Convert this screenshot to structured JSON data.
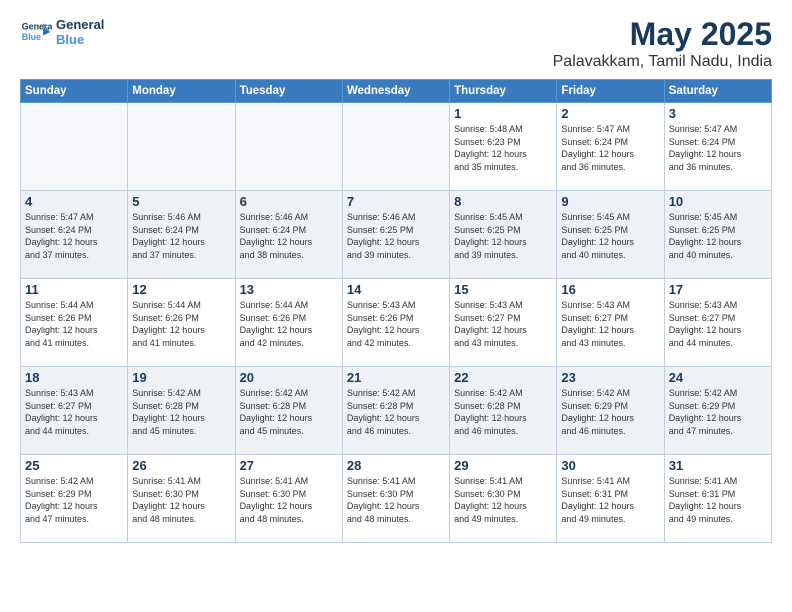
{
  "header": {
    "logo_general": "General",
    "logo_blue": "Blue",
    "title": "May 2025",
    "subtitle": "Palavakkam, Tamil Nadu, India"
  },
  "weekdays": [
    "Sunday",
    "Monday",
    "Tuesday",
    "Wednesday",
    "Thursday",
    "Friday",
    "Saturday"
  ],
  "weeks": [
    [
      {
        "day": "",
        "info": ""
      },
      {
        "day": "",
        "info": ""
      },
      {
        "day": "",
        "info": ""
      },
      {
        "day": "",
        "info": ""
      },
      {
        "day": "1",
        "info": "Sunrise: 5:48 AM\nSunset: 6:23 PM\nDaylight: 12 hours\nand 35 minutes."
      },
      {
        "day": "2",
        "info": "Sunrise: 5:47 AM\nSunset: 6:24 PM\nDaylight: 12 hours\nand 36 minutes."
      },
      {
        "day": "3",
        "info": "Sunrise: 5:47 AM\nSunset: 6:24 PM\nDaylight: 12 hours\nand 36 minutes."
      }
    ],
    [
      {
        "day": "4",
        "info": "Sunrise: 5:47 AM\nSunset: 6:24 PM\nDaylight: 12 hours\nand 37 minutes."
      },
      {
        "day": "5",
        "info": "Sunrise: 5:46 AM\nSunset: 6:24 PM\nDaylight: 12 hours\nand 37 minutes."
      },
      {
        "day": "6",
        "info": "Sunrise: 5:46 AM\nSunset: 6:24 PM\nDaylight: 12 hours\nand 38 minutes."
      },
      {
        "day": "7",
        "info": "Sunrise: 5:46 AM\nSunset: 6:25 PM\nDaylight: 12 hours\nand 39 minutes."
      },
      {
        "day": "8",
        "info": "Sunrise: 5:45 AM\nSunset: 6:25 PM\nDaylight: 12 hours\nand 39 minutes."
      },
      {
        "day": "9",
        "info": "Sunrise: 5:45 AM\nSunset: 6:25 PM\nDaylight: 12 hours\nand 40 minutes."
      },
      {
        "day": "10",
        "info": "Sunrise: 5:45 AM\nSunset: 6:25 PM\nDaylight: 12 hours\nand 40 minutes."
      }
    ],
    [
      {
        "day": "11",
        "info": "Sunrise: 5:44 AM\nSunset: 6:26 PM\nDaylight: 12 hours\nand 41 minutes."
      },
      {
        "day": "12",
        "info": "Sunrise: 5:44 AM\nSunset: 6:26 PM\nDaylight: 12 hours\nand 41 minutes."
      },
      {
        "day": "13",
        "info": "Sunrise: 5:44 AM\nSunset: 6:26 PM\nDaylight: 12 hours\nand 42 minutes."
      },
      {
        "day": "14",
        "info": "Sunrise: 5:43 AM\nSunset: 6:26 PM\nDaylight: 12 hours\nand 42 minutes."
      },
      {
        "day": "15",
        "info": "Sunrise: 5:43 AM\nSunset: 6:27 PM\nDaylight: 12 hours\nand 43 minutes."
      },
      {
        "day": "16",
        "info": "Sunrise: 5:43 AM\nSunset: 6:27 PM\nDaylight: 12 hours\nand 43 minutes."
      },
      {
        "day": "17",
        "info": "Sunrise: 5:43 AM\nSunset: 6:27 PM\nDaylight: 12 hours\nand 44 minutes."
      }
    ],
    [
      {
        "day": "18",
        "info": "Sunrise: 5:43 AM\nSunset: 6:27 PM\nDaylight: 12 hours\nand 44 minutes."
      },
      {
        "day": "19",
        "info": "Sunrise: 5:42 AM\nSunset: 6:28 PM\nDaylight: 12 hours\nand 45 minutes."
      },
      {
        "day": "20",
        "info": "Sunrise: 5:42 AM\nSunset: 6:28 PM\nDaylight: 12 hours\nand 45 minutes."
      },
      {
        "day": "21",
        "info": "Sunrise: 5:42 AM\nSunset: 6:28 PM\nDaylight: 12 hours\nand 46 minutes."
      },
      {
        "day": "22",
        "info": "Sunrise: 5:42 AM\nSunset: 6:28 PM\nDaylight: 12 hours\nand 46 minutes."
      },
      {
        "day": "23",
        "info": "Sunrise: 5:42 AM\nSunset: 6:29 PM\nDaylight: 12 hours\nand 46 minutes."
      },
      {
        "day": "24",
        "info": "Sunrise: 5:42 AM\nSunset: 6:29 PM\nDaylight: 12 hours\nand 47 minutes."
      }
    ],
    [
      {
        "day": "25",
        "info": "Sunrise: 5:42 AM\nSunset: 6:29 PM\nDaylight: 12 hours\nand 47 minutes."
      },
      {
        "day": "26",
        "info": "Sunrise: 5:41 AM\nSunset: 6:30 PM\nDaylight: 12 hours\nand 48 minutes."
      },
      {
        "day": "27",
        "info": "Sunrise: 5:41 AM\nSunset: 6:30 PM\nDaylight: 12 hours\nand 48 minutes."
      },
      {
        "day": "28",
        "info": "Sunrise: 5:41 AM\nSunset: 6:30 PM\nDaylight: 12 hours\nand 48 minutes."
      },
      {
        "day": "29",
        "info": "Sunrise: 5:41 AM\nSunset: 6:30 PM\nDaylight: 12 hours\nand 49 minutes."
      },
      {
        "day": "30",
        "info": "Sunrise: 5:41 AM\nSunset: 6:31 PM\nDaylight: 12 hours\nand 49 minutes."
      },
      {
        "day": "31",
        "info": "Sunrise: 5:41 AM\nSunset: 6:31 PM\nDaylight: 12 hours\nand 49 minutes."
      }
    ]
  ]
}
